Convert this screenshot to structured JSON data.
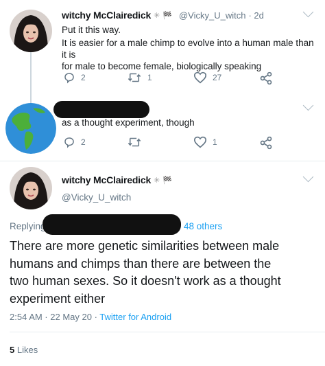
{
  "tweet1": {
    "name": "witchy McClairedick",
    "handle": "@Vicky_U_witch",
    "time": "· 2d",
    "line1": "Put it this way.",
    "line2": "It is easier for a male chimp to evolve into a human male than it is",
    "line3": "for male to become female, biologically speaking",
    "replies": "2",
    "retweets": "1",
    "likes": "27"
  },
  "tweet2": {
    "text": "as a thought experiment, though",
    "replies": "2",
    "retweets": "",
    "likes": "1"
  },
  "main": {
    "name": "witchy McClairedick",
    "handle": "@Vicky_U_witch",
    "replying_prefix": "Replying",
    "replying_suffix": "48 others",
    "line1": "There are more genetic similarities between male",
    "line2": "humans and chimps than there are between the",
    "line3": "two human sexes. So it doesn't work as a thought",
    "line4": "experiment either",
    "meta_time": "2:54 AM · 22 May 20 ·",
    "meta_source": "Twitter for Android",
    "likes_count": "5",
    "likes_label": "Likes"
  },
  "colors": {
    "link": "#1da1f2",
    "muted": "#657786",
    "divider": "#e6ecf0"
  }
}
